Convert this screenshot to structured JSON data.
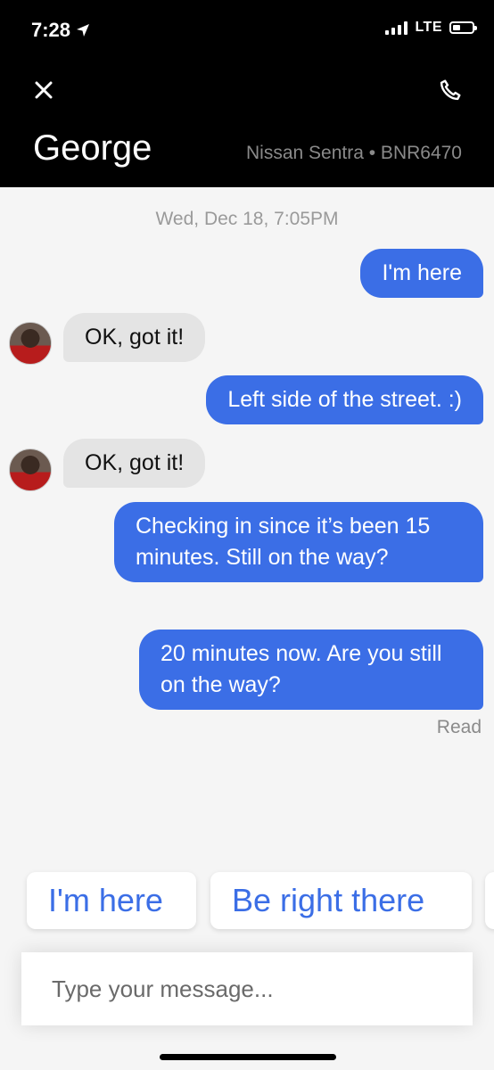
{
  "status_bar": {
    "time": "7:28",
    "network": "LTE",
    "location_icon": "location-arrow-icon",
    "signal_icon": "signal-bars-icon",
    "battery_icon": "battery-icon"
  },
  "header": {
    "close_icon": "close-icon",
    "call_icon": "phone-icon",
    "driver_name": "George",
    "vehicle": "Nissan Sentra • BNR6470"
  },
  "conversation": {
    "date": "Wed, Dec 18, 7:05PM",
    "messages": [
      {
        "direction": "outgoing",
        "text": "I'm here"
      },
      {
        "direction": "incoming",
        "text": "OK, got it!"
      },
      {
        "direction": "outgoing",
        "text": "Left side of the street. :)"
      },
      {
        "direction": "incoming",
        "text": "OK, got it!"
      },
      {
        "direction": "outgoing",
        "text": "Checking in since it’s been 15 minutes. Still on the way?"
      },
      {
        "direction": "outgoing",
        "text": "20 minutes now. Are you still on the way?"
      }
    ],
    "read_receipt": "Read"
  },
  "quick_replies": [
    "I'm here",
    "Be right there"
  ],
  "composer": {
    "placeholder": "Type your message..."
  },
  "colors": {
    "accent": "#3b6ee6",
    "header_bg": "#000000",
    "incoming_bubble": "#e4e4e4",
    "background": "#f5f5f5"
  }
}
